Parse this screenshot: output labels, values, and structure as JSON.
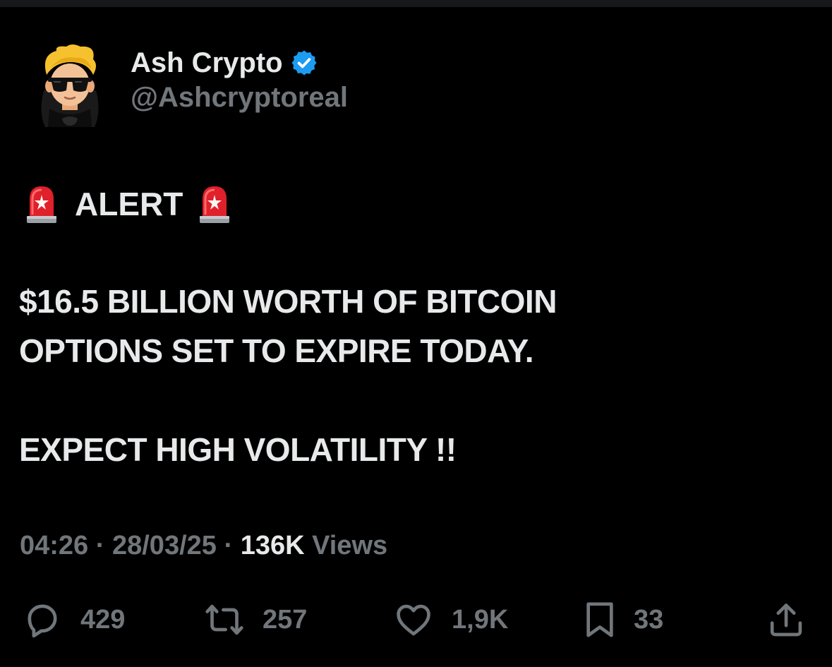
{
  "author": {
    "display_name": "Ash Crypto",
    "handle": "@Ashcryptoreal",
    "verified": true
  },
  "tweet": {
    "alert_word": "ALERT",
    "alert_icon": "police-car-light-emoji",
    "lines": [
      "$16.5 BILLION WORTH OF BITCOIN",
      "OPTIONS SET TO EXPIRE TODAY.",
      "EXPECT HIGH VOLATILITY !!"
    ]
  },
  "meta": {
    "time": "04:26",
    "separator": " · ",
    "date": "28/03/25",
    "views_count": "136K",
    "views_label": "Views"
  },
  "actions": {
    "replies": "429",
    "reposts": "257",
    "likes": "1,9K",
    "bookmarks": "33"
  },
  "colors": {
    "background": "#000000",
    "primary_text": "#e7e9ea",
    "secondary_text": "#71767b",
    "verified_badge": "#1d9bf0",
    "siren_red": "#e0202a"
  }
}
